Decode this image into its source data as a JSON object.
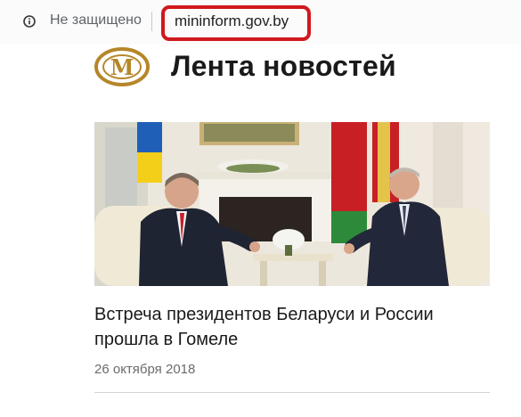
{
  "browser": {
    "security_label": "Не защищено",
    "url": "mininform.gov.by",
    "info_icon": "info-circle-icon"
  },
  "header": {
    "title": "Лента новостей",
    "logo_letter": "M",
    "logo_icon": "ministry-logo"
  },
  "article": {
    "headline_line1": "Встреча президентов Беларуси и России",
    "headline_line2": "прошла в Гомеле",
    "date": "26 октября 2018"
  },
  "colors": {
    "highlight": "#d0191e",
    "logo_gold": "#b5872a",
    "flag_ukraine_blue": "#1f5fb8",
    "flag_ukraine_yellow": "#f3cf1a",
    "flag_belarus_red": "#c81f25",
    "flag_belarus_green": "#2d8a3b"
  }
}
